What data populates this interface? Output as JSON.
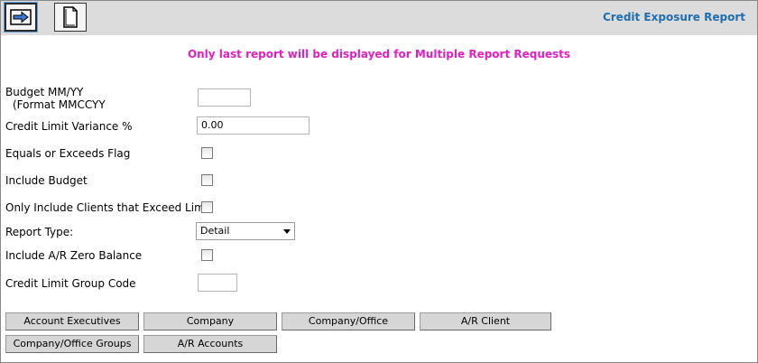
{
  "header": {
    "title": "Credit Exposure Report",
    "go_icon": "arrow-right-icon",
    "new_icon": "document-icon"
  },
  "notice": "Only last report will be displayed for Multiple Report Requests",
  "form": {
    "budget_label_line1": "Budget MM/YY",
    "budget_label_line2": "(Format MMCCYY",
    "budget_value": "",
    "variance_label": "Credit Limit Variance %",
    "variance_value": "0.00",
    "equals_flag_label": "Equals or Exceeds Flag",
    "include_budget_label": "Include Budget",
    "exceed_limit_label": "Only Include Clients that Exceed Limit",
    "report_type_label": "Report Type:",
    "report_type_value": "Detail",
    "ar_zero_label": "Include A/R Zero Balance",
    "group_code_label": "Credit Limit Group Code",
    "group_code_value": ""
  },
  "buttons": {
    "account_executives": "Account Executives",
    "company": "Company",
    "company_office": "Company/Office",
    "ar_client": "A/R Client",
    "company_office_groups": "Company/Office Groups",
    "ar_accounts": "A/R Accounts"
  },
  "colors": {
    "title": "#1f6fb0",
    "notice": "#e020c0",
    "toolbar": "#dcdcdc"
  }
}
